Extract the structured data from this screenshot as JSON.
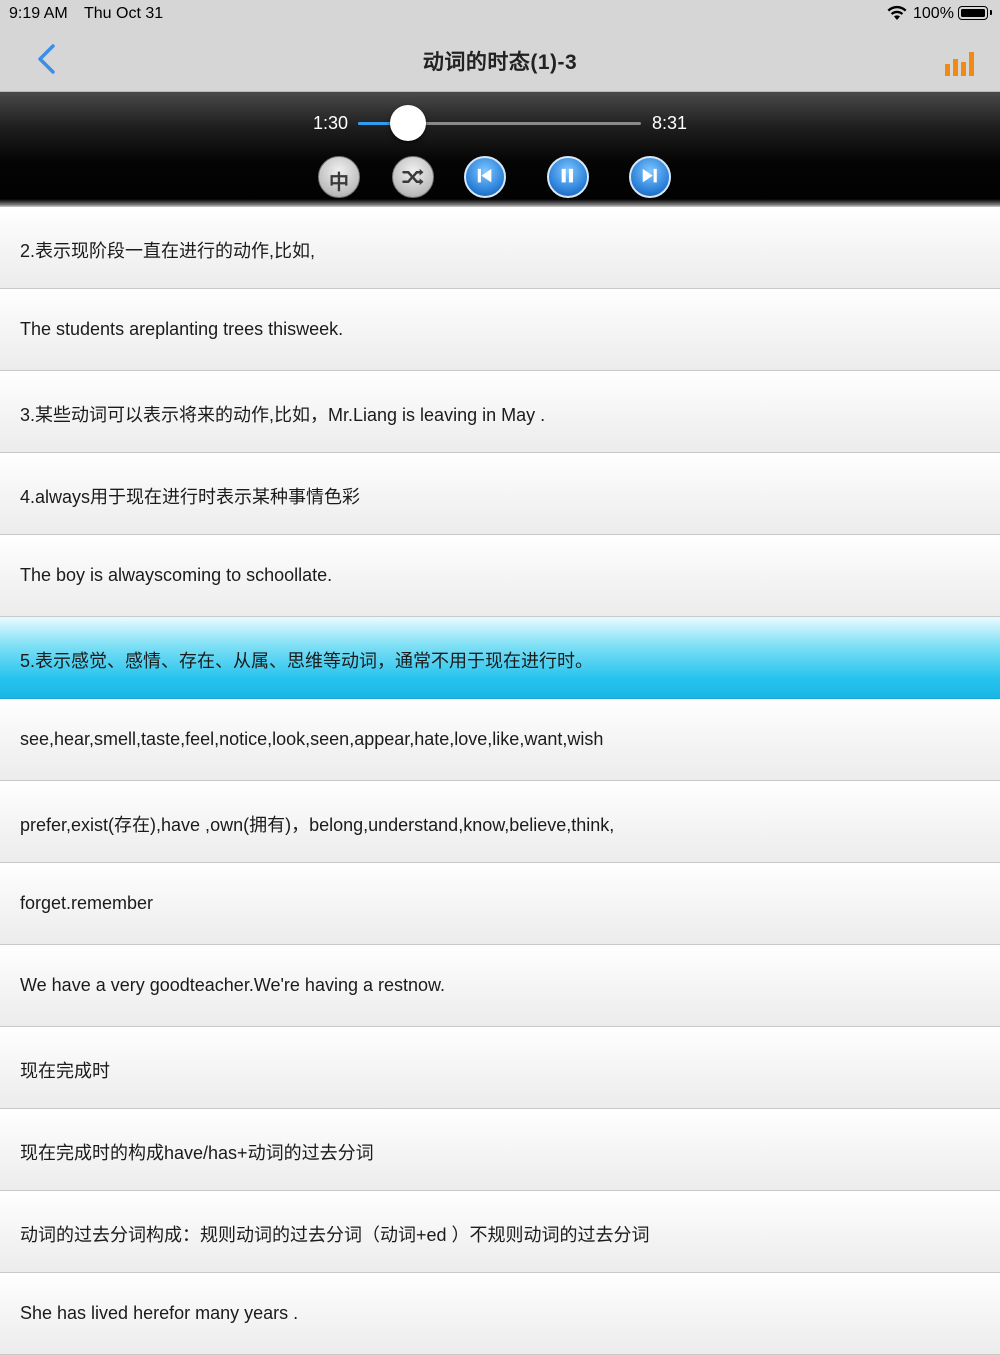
{
  "status_bar": {
    "time": "9:19 AM",
    "date": "Thu Oct 31",
    "battery_percent": "100%"
  },
  "nav": {
    "title": "动词的时态(1)-3",
    "accent_color": "#3b8ee8",
    "chart_icon_color": "#f08a12"
  },
  "player": {
    "current_time": "1:30",
    "total_time": "8:31",
    "progress_fraction": 0.176,
    "chinese_toggle_label": "中",
    "controls": [
      "chinese-toggle",
      "shuffle",
      "previous",
      "pause",
      "next"
    ]
  },
  "lines": [
    "2.表示现阶段一直在进行的动作,比如,",
    "The students areplanting trees thisweek.",
    "3.某些动词可以表示将来的动作,比如，Mr.Liang is leaving in May .",
    "4.always用于现在进行时表示某种事情色彩",
    "The boy is alwayscoming to schoollate.",
    "5.表示感觉、感情、存在、从属、思维等动词，通常不用于现在进行时。",
    "see,hear,smell,taste,feel,notice,look,seen,appear,hate,love,like,want,wish",
    "prefer,exist(存在),have ,own(拥有)，belong,understand,know,believe,think,",
    "forget.remember",
    "We have a very goodteacher.We're having a restnow.",
    "现在完成时",
    "现在完成时的构成have/has+动词的过去分词",
    "动词的过去分词构成：规则动词的过去分词（动词+ed ）不规则动词的过去分词",
    "She has lived herefor many years ."
  ],
  "active_line_index": 5
}
